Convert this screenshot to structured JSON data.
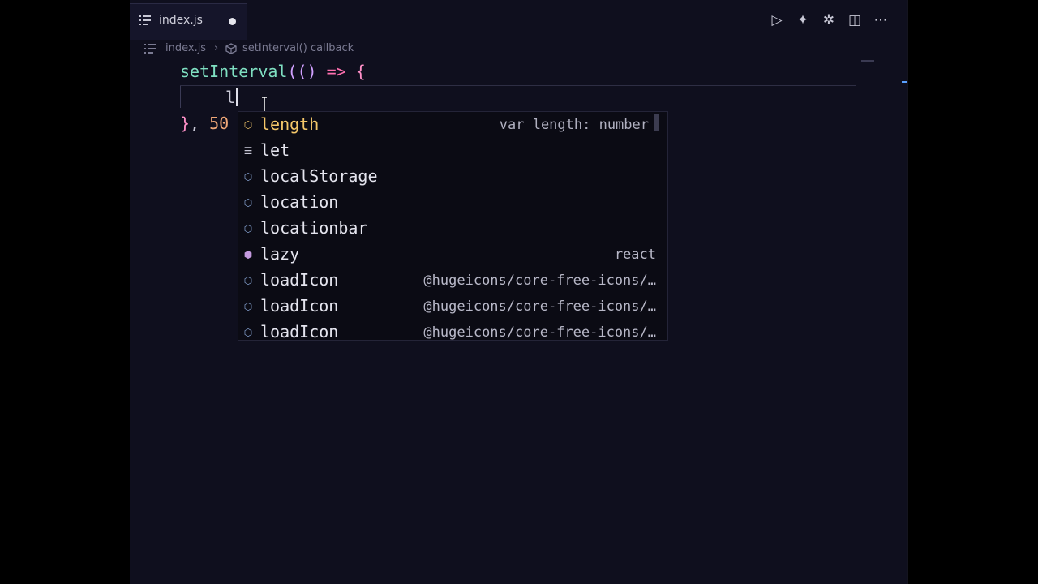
{
  "tab": {
    "label": "index.js",
    "icon": "list-icon",
    "dirty": true
  },
  "breadcrumb": {
    "file": "index.js",
    "symbol": "setInterval() callback",
    "symbol_icon": "cube-icon"
  },
  "editor_actions": [
    {
      "name": "run-icon",
      "glyph": "▷"
    },
    {
      "name": "sparkle-icon",
      "glyph": "✦"
    },
    {
      "name": "openai-icon",
      "glyph": "✲"
    },
    {
      "name": "split-editor-icon",
      "glyph": "◫"
    },
    {
      "name": "more-icon",
      "glyph": "⋯"
    }
  ],
  "code": {
    "line1": {
      "fn": "setInterval",
      "open": "(()",
      "arrow": "=>",
      "brace": "{"
    },
    "line2": {
      "typed": "l"
    },
    "line3": {
      "close": "}",
      "comma": ",",
      "num": "50"
    }
  },
  "suggest": {
    "items": [
      {
        "label": "length",
        "detail": "var length: number",
        "icon": "variable-icon",
        "selected": true
      },
      {
        "label": "let",
        "detail": "",
        "icon": "keyword-icon",
        "selected": false
      },
      {
        "label": "localStorage",
        "detail": "",
        "icon": "variable-icon",
        "selected": false
      },
      {
        "label": "location",
        "detail": "",
        "icon": "variable-icon",
        "selected": false
      },
      {
        "label": "locationbar",
        "detail": "",
        "icon": "variable-icon",
        "selected": false
      },
      {
        "label": "lazy",
        "detail": "react",
        "icon": "method-icon",
        "selected": false
      },
      {
        "label": "loadIcon",
        "detail": "@hugeicons/core-free-icons/…",
        "icon": "variable-icon",
        "selected": false
      },
      {
        "label": "loadIcon",
        "detail": "@hugeicons/core-free-icons/…",
        "icon": "variable-icon",
        "selected": false
      },
      {
        "label": "loadIcon",
        "detail": "@hugeicons/core-free-icons/…",
        "icon": "variable-icon",
        "selected": false
      }
    ]
  },
  "colors": {
    "background": "#0f0f1e",
    "function": "#7fe0c2",
    "selected_suggestion": "#f5c86a",
    "number": "#f0a878"
  }
}
